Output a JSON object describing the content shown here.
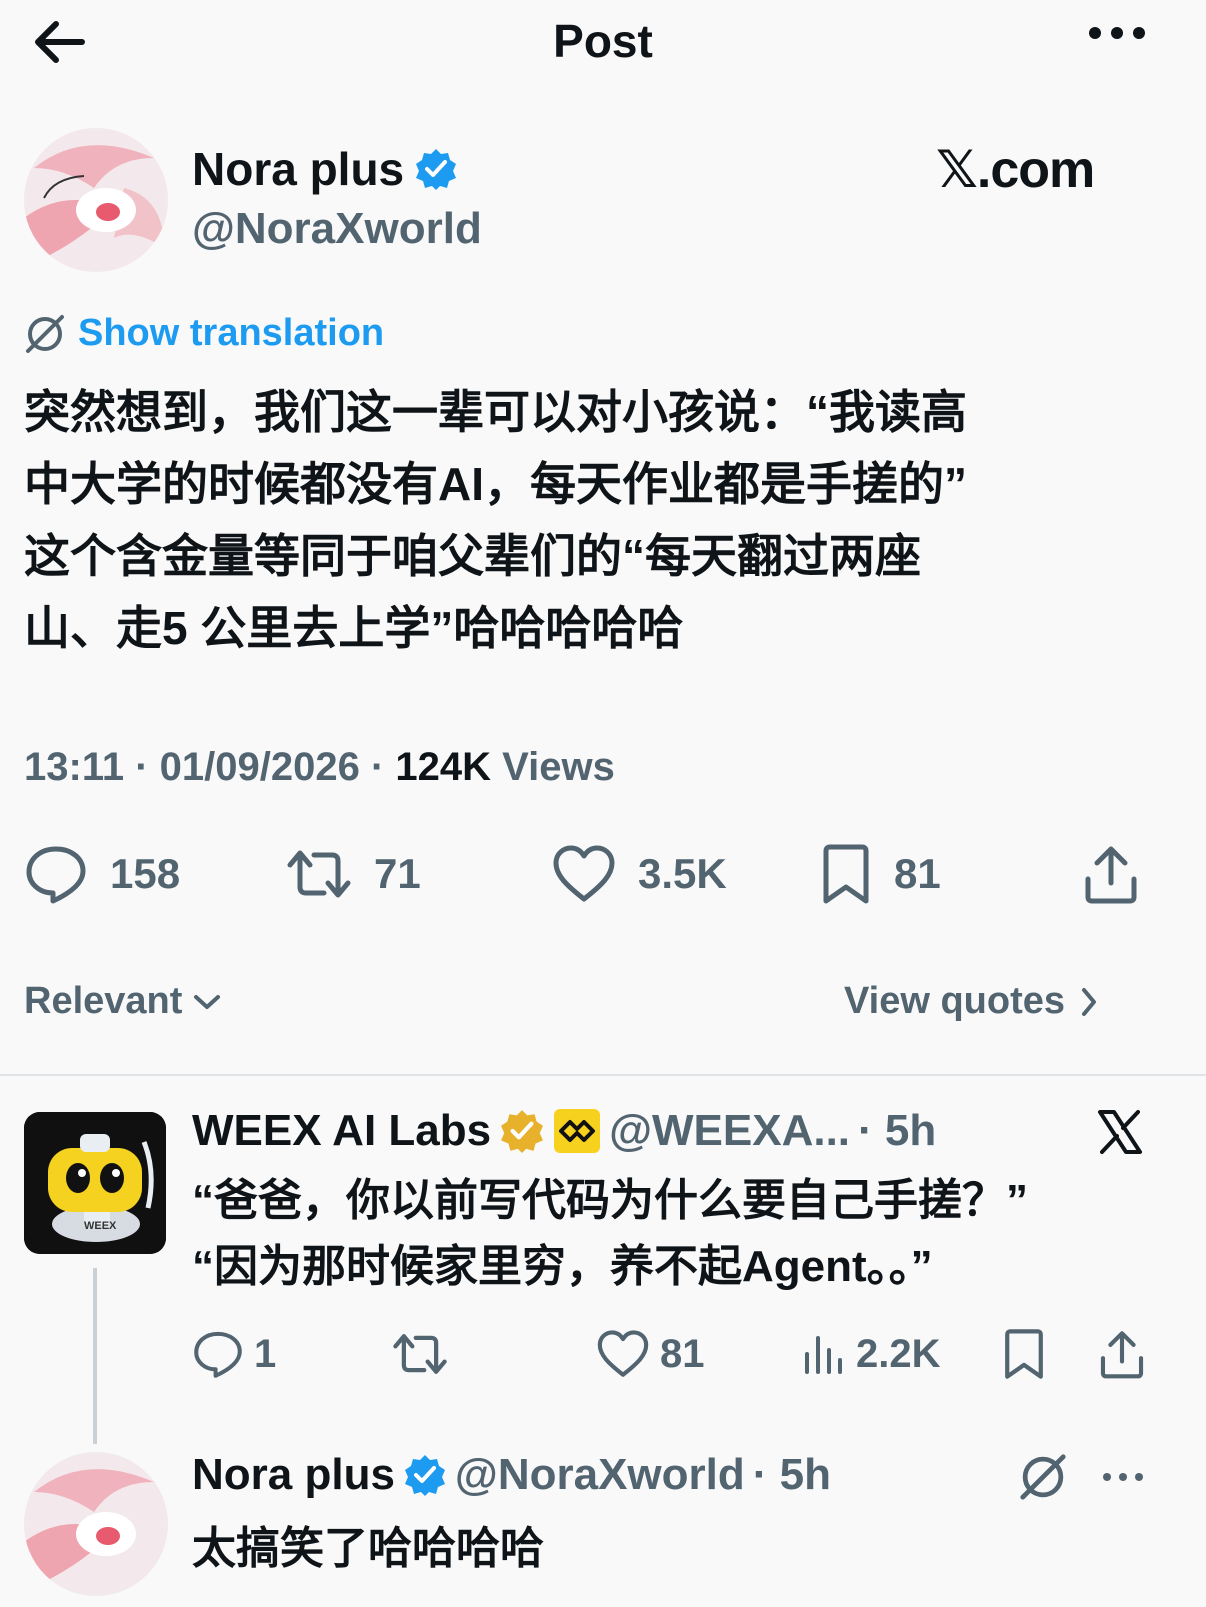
{
  "header": {
    "title": "Post",
    "back_icon": "arrow-left-icon",
    "more_icon": "more-horizontal-icon"
  },
  "post": {
    "author": {
      "name": "Nora plus",
      "handle": "@NoraXworld",
      "verified_icon": "verified-badge-icon"
    },
    "brand_text": "𝕏.com",
    "translate_label": "Show translation",
    "text_lines": [
      "突然想到，我们这一辈可以对小孩说：“我读高",
      "中大学的时候都没有AI，每天作业都是手搓的”",
      "这个含金量等同于咱父辈们的“每天翻过两座",
      "山、走5 公里去上学”哈哈哈哈哈"
    ],
    "meta": {
      "time": "13:11",
      "sep": " · ",
      "date": "01/09/2026",
      "views_count": "124K",
      "views_label": " Views"
    },
    "stats": {
      "replies": "158",
      "reposts": "71",
      "likes": "3.5K",
      "bookmarks": "81"
    }
  },
  "filters": {
    "sort_label": "Relevant",
    "quotes_label": "View quotes"
  },
  "replies": [
    {
      "name": "WEEX AI Labs",
      "handle": "@WEEXA...",
      "time": " · 5h",
      "avatar_text": "WEEX",
      "text_lines": [
        "“爸爸，你以前写代码为什么要自己手搓？”",
        "“因为那时候家里穷，养不起Agent。。”"
      ],
      "stats": {
        "replies": "1",
        "reposts": "",
        "likes": "81",
        "views": "2.2K"
      }
    },
    {
      "name": "Nora plus",
      "handle": "@NoraXworld",
      "time": " · 5h",
      "text": "太搞笑了哈哈哈哈"
    }
  ],
  "colors": {
    "accent": "#1d9bf0",
    "gold": "#e8b12b",
    "text": "#0f1419",
    "muted": "#536471",
    "background": "#f9f9f9"
  }
}
